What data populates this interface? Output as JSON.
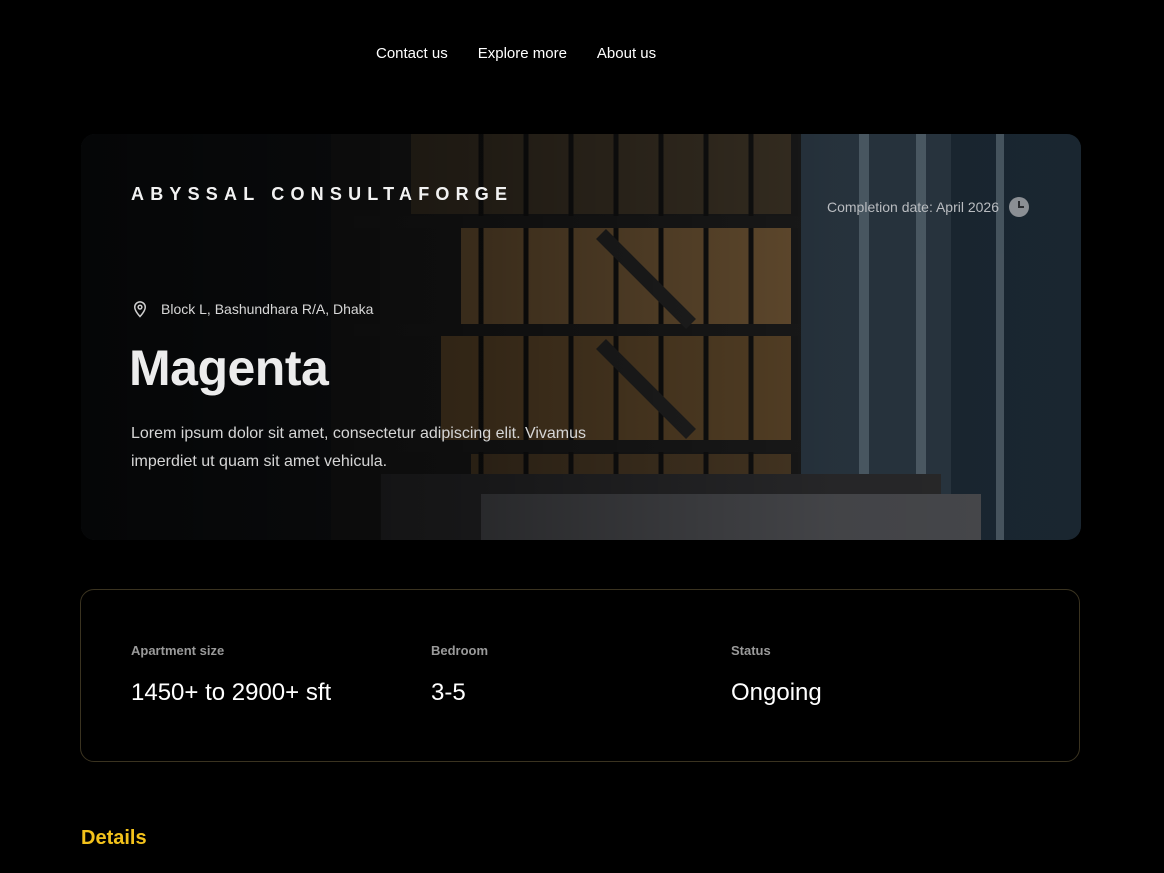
{
  "nav": {
    "items": [
      "Contact us",
      "Explore more",
      "About us"
    ]
  },
  "hero": {
    "brand": "ABYSSAL CONSULTAFORGE",
    "completion": "Completion date: April 2026",
    "location": "Block L, Bashundhara R/A, Dhaka",
    "title": "Magenta",
    "description": "Lorem ipsum dolor sit amet, consectetur adipiscing elit. Vivamus imperdiet ut quam sit amet vehicula."
  },
  "stats": {
    "apartment_size": {
      "label": "Apartment size",
      "value": "1450+ to 2900+ sft"
    },
    "bedroom": {
      "label": "Bedroom",
      "value": "3-5"
    },
    "status": {
      "label": "Status",
      "value": "Ongoing"
    }
  },
  "details": {
    "heading": "Details"
  },
  "colors": {
    "accent": "#f3c21b",
    "background": "#000000",
    "card_border": "#3a3320"
  }
}
